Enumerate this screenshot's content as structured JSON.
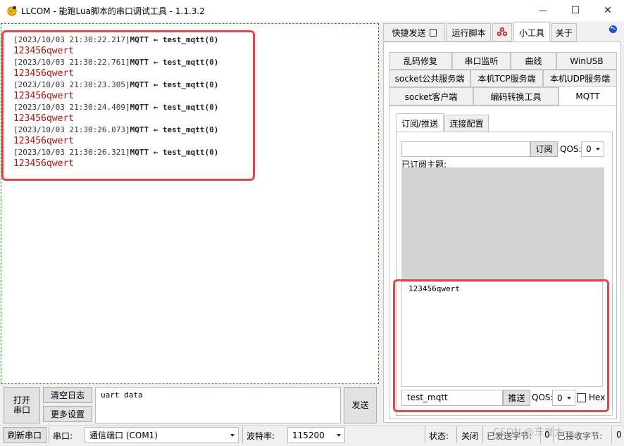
{
  "window": {
    "title": "LLCOM - 能跑Lua脚本的串口调试工具 - 1.1.3.2",
    "minimize_glyph": "—",
    "maximize_glyph": "☐",
    "close_glyph": "✕"
  },
  "log": {
    "entries": [
      {
        "timestamp": "[2023/10/03 21:30:22.217]",
        "message": "MQTT ← test_mqtt(0)",
        "data": "123456qwert"
      },
      {
        "timestamp": "[2023/10/03 21:30:22.761]",
        "message": "MQTT ← test_mqtt(0)",
        "data": "123456qwert"
      },
      {
        "timestamp": "[2023/10/03 21:30:23.305]",
        "message": "MQTT ← test_mqtt(0)",
        "data": "123456qwert"
      },
      {
        "timestamp": "[2023/10/03 21:30:24.409]",
        "message": "MQTT ← test_mqtt(0)",
        "data": "123456qwert"
      },
      {
        "timestamp": "[2023/10/03 21:30:26.073]",
        "message": "MQTT ← test_mqtt(0)",
        "data": "123456qwert"
      },
      {
        "timestamp": "[2023/10/03 21:30:26.321]",
        "message": "MQTT ← test_mqtt(0)",
        "data": "123456qwert"
      }
    ]
  },
  "bottom": {
    "open_port_line1": "打开",
    "open_port_line2": "串口",
    "clear_log": "清空日志",
    "more_settings": "更多设置",
    "send_text": "uart data",
    "send": "发送"
  },
  "statusbar": {
    "refresh_port": "刷新串口",
    "port_label": "串口:",
    "port_value": "通信端口 (COM1)",
    "baud_label": "波特率:",
    "baud_value": "115200",
    "state_label": "状态:",
    "state_value": "关闭",
    "sent_label": "已发送字节:",
    "sent_value": "0",
    "recv_label": "已接收字节:",
    "recv_value": "0",
    "watermark": "CSDN @东皇太一"
  },
  "top_tabs": [
    {
      "label": "快捷发送",
      "active": false
    },
    {
      "label": "运行脚本",
      "active": false
    },
    {
      "label": "",
      "active": false
    },
    {
      "label": "小工具",
      "active": true
    },
    {
      "label": "关于",
      "active": false
    }
  ],
  "tool_tabs": {
    "row1": [
      "乱码修复",
      "串口监听",
      "曲线",
      "WinUSB"
    ],
    "row2": [
      "socket公共服务端",
      "本机TCP服务端",
      "本机UDP服务端"
    ],
    "row3": [
      "socket客户端",
      "编码转换工具",
      "MQTT"
    ]
  },
  "mqtt": {
    "sub_tabs": [
      "订阅/推送",
      "连接配置"
    ],
    "subscribe_topic_value": "",
    "subscribe_button": "订阅",
    "qos_label": "QOS:",
    "qos_value": "0",
    "subscribed_label": "已订阅主题:",
    "received_text": "123456qwert",
    "publish_topic_value": "test_mqtt",
    "publish_button": "推送",
    "publish_qos_label": "QOS:",
    "publish_qos_value": "0",
    "hex_label": "Hex"
  },
  "colors": {
    "highlight": "#e2474c",
    "log_data": "#a01818",
    "log_border": "#3c8c3c"
  }
}
